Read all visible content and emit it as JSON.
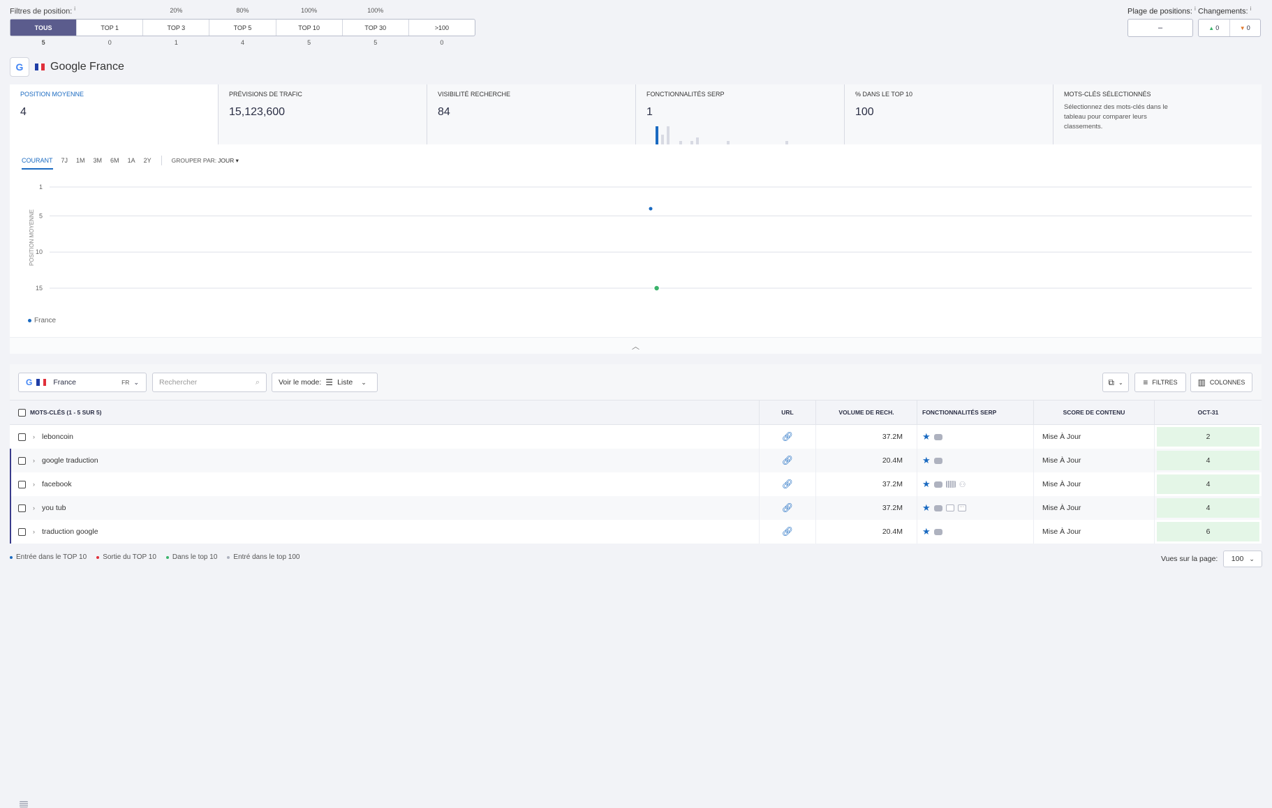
{
  "filters": {
    "title": "Filtres de position:",
    "info": "i",
    "segments": [
      {
        "label": "TOUS",
        "pct": "",
        "count": "5",
        "active": true
      },
      {
        "label": "TOP 1",
        "pct": "",
        "count": "0"
      },
      {
        "label": "TOP 3",
        "pct": "20%",
        "count": "1"
      },
      {
        "label": "TOP 5",
        "pct": "80%",
        "count": "4"
      },
      {
        "label": "TOP 10",
        "pct": "100%",
        "count": "5"
      },
      {
        "label": "TOP 30",
        "pct": "100%",
        "count": "5"
      },
      {
        "label": ">100",
        "pct": "",
        "count": "0"
      }
    ],
    "range_label": "Plage de positions:",
    "range_value": "–",
    "changes_label": "Changements:",
    "changes_up": "0",
    "changes_down": "0"
  },
  "engine": {
    "logo": "G",
    "name": "Google France"
  },
  "metrics": [
    {
      "label": "POSITION MOYENNE",
      "value": "4"
    },
    {
      "label": "PRÉVISIONS DE TRAFIC",
      "value": "15,123,600"
    },
    {
      "label": "VISIBILITÉ RECHERCHE",
      "value": "84"
    },
    {
      "label": "FONCTIONNALITÉS SERP",
      "value": "1"
    },
    {
      "label": "% DANS LE TOP 10",
      "value": "100"
    },
    {
      "label": "MOTS-CLÉS SÉLECTIONNÉS",
      "desc": "Sélectionnez des mots-clés dans le tableau pour comparer leurs classements."
    }
  ],
  "chart_controls": {
    "tabs": [
      "COURANT",
      "7J",
      "1M",
      "3M",
      "6M",
      "1A",
      "2Y"
    ],
    "active_tab": "COURANT",
    "group_label": "GROUPER PAR:",
    "group_value": "JOUR"
  },
  "chart_data": {
    "type": "scatter",
    "ylabel": "POSITION MOYENNE",
    "y_ticks": [
      1,
      5,
      10,
      15
    ],
    "ylim": [
      1,
      15
    ],
    "y_inverted": true,
    "series": [
      {
        "name": "France",
        "color": "#1a6ac1",
        "points": [
          {
            "x": 0.5,
            "y": 4
          }
        ]
      },
      {
        "color": "#3bb36b",
        "points": [
          {
            "x": 0.505,
            "y": 15
          }
        ]
      }
    ]
  },
  "legend": {
    "france": "France"
  },
  "toolbar": {
    "engine_logo": "G",
    "country": "France",
    "lang": "FR",
    "search_placeholder": "Rechercher",
    "view_label": "Voir le mode:",
    "view_value": "Liste",
    "filters_label": "FILTRES",
    "columns_label": "COLONNES"
  },
  "table": {
    "headers": {
      "keywords": "MOTS-CLÉS (1 - 5 SUR 5)",
      "url": "URL",
      "volume": "VOLUME DE RECH.",
      "serp": "FONCTIONNALITÉS SERP",
      "score": "SCORE DE CONTENU",
      "date": "OCT-31"
    },
    "rows": [
      {
        "keyword": "leboncoin",
        "volume": "37.2M",
        "score": "Mise À Jour",
        "position": "2",
        "serp": [
          "star",
          "table",
          "video"
        ]
      },
      {
        "keyword": "google traduction",
        "volume": "20.4M",
        "score": "Mise À Jour",
        "position": "4",
        "serp": [
          "star",
          "video"
        ]
      },
      {
        "keyword": "facebook",
        "volume": "37.2M",
        "score": "Mise À Jour",
        "position": "4",
        "serp": [
          "star",
          "table",
          "video",
          "carousel",
          "tree"
        ]
      },
      {
        "keyword": "you tub",
        "volume": "37.2M",
        "score": "Mise À Jour",
        "position": "4",
        "serp": [
          "star",
          "table",
          "video",
          "image",
          "more"
        ]
      },
      {
        "keyword": "traduction google",
        "volume": "20.4M",
        "score": "Mise À Jour",
        "position": "6",
        "serp": [
          "star",
          "video"
        ]
      }
    ]
  },
  "footer": {
    "legend": [
      {
        "label": "Entrée dans le TOP 10",
        "color": "#1a6ac1"
      },
      {
        "label": "Sortie du TOP 10",
        "color": "#e0303b"
      },
      {
        "label": "Dans le top 10",
        "color": "#3bb36b"
      },
      {
        "label": "Entré dans le top 100",
        "color": "#aeb2bf"
      }
    ],
    "per_page_label": "Vues sur la page:",
    "per_page_value": "100"
  }
}
